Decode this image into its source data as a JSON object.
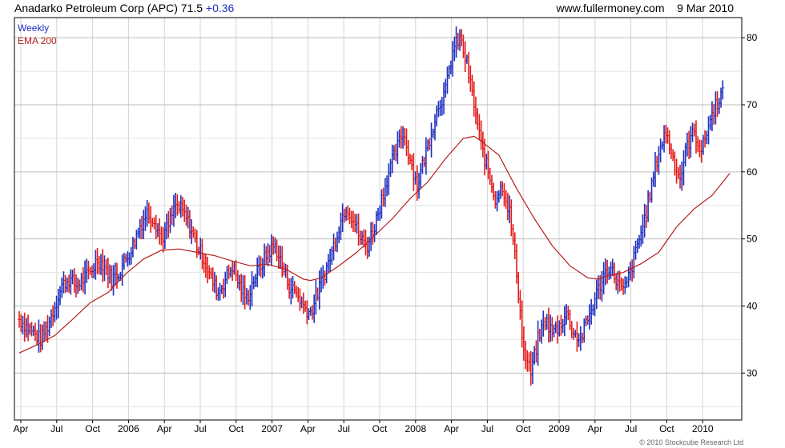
{
  "header": {
    "title": "Anadarko Petroleum Corp (APC) 71.5",
    "change": "+0.36",
    "source": "www.fullermoney.com",
    "date": "9 Mar 2010"
  },
  "legend": {
    "period": "Weekly",
    "ema": "EMA 200"
  },
  "footer": {
    "copyright": "© 2010 Stockcube Research Ltd"
  },
  "colors": {
    "up": "#1f2fbf",
    "down": "#e41a1a",
    "ema": "#b41e1e",
    "grid": "#d4d4d4"
  },
  "chart_data": {
    "type": "line",
    "title": "Anadarko Petroleum Corp (APC) 71.5",
    "x_ticks": [
      "Apr",
      "Jul",
      "Oct",
      "2006",
      "Apr",
      "Jul",
      "Oct",
      "2007",
      "Apr",
      "Jul",
      "Oct",
      "2008",
      "Apr",
      "Jul",
      "Oct",
      "2009",
      "Apr",
      "Jul",
      "Oct",
      "2010"
    ],
    "y_ticks": [
      30,
      40,
      50,
      60,
      70,
      80
    ],
    "ylim": [
      23,
      83
    ],
    "grid": true,
    "legend_position": "top-left",
    "series": [
      {
        "name": "Weekly",
        "style": "price bars",
        "points": [
          [
            0,
            38
          ],
          [
            2,
            37
          ],
          [
            4,
            36
          ],
          [
            6,
            35
          ],
          [
            8,
            37
          ],
          [
            10,
            40
          ],
          [
            12,
            43
          ],
          [
            14,
            44
          ],
          [
            16,
            43
          ],
          [
            18,
            44
          ],
          [
            20,
            45
          ],
          [
            22,
            47
          ],
          [
            24,
            46
          ],
          [
            26,
            44
          ],
          [
            28,
            45
          ],
          [
            30,
            47
          ],
          [
            32,
            49
          ],
          [
            34,
            52
          ],
          [
            36,
            54
          ],
          [
            38,
            53
          ],
          [
            40,
            50
          ],
          [
            42,
            52
          ],
          [
            44,
            55
          ],
          [
            46,
            54
          ],
          [
            48,
            52
          ],
          [
            50,
            49
          ],
          [
            52,
            47
          ],
          [
            54,
            44
          ],
          [
            56,
            42
          ],
          [
            58,
            44
          ],
          [
            60,
            46
          ],
          [
            62,
            43
          ],
          [
            64,
            41
          ],
          [
            66,
            44
          ],
          [
            68,
            46
          ],
          [
            70,
            48
          ],
          [
            72,
            49
          ],
          [
            74,
            46
          ],
          [
            76,
            43
          ],
          [
            78,
            42
          ],
          [
            80,
            40
          ],
          [
            82,
            39
          ],
          [
            84,
            42
          ],
          [
            86,
            45
          ],
          [
            88,
            48
          ],
          [
            90,
            52
          ],
          [
            92,
            55
          ],
          [
            94,
            53
          ],
          [
            96,
            50
          ],
          [
            98,
            49
          ],
          [
            100,
            52
          ],
          [
            102,
            56
          ],
          [
            104,
            60
          ],
          [
            106,
            63
          ],
          [
            108,
            66
          ],
          [
            110,
            62
          ],
          [
            112,
            58
          ],
          [
            114,
            62
          ],
          [
            116,
            66
          ],
          [
            118,
            70
          ],
          [
            120,
            72
          ],
          [
            122,
            78
          ],
          [
            124,
            80
          ],
          [
            126,
            76
          ],
          [
            128,
            70
          ],
          [
            130,
            64
          ],
          [
            132,
            60
          ],
          [
            134,
            56
          ],
          [
            136,
            58
          ],
          [
            138,
            54
          ],
          [
            140,
            45
          ],
          [
            142,
            33
          ],
          [
            144,
            30
          ],
          [
            146,
            35
          ],
          [
            148,
            38
          ],
          [
            150,
            36
          ],
          [
            152,
            37
          ],
          [
            154,
            39
          ],
          [
            156,
            36
          ],
          [
            158,
            35
          ],
          [
            160,
            38
          ],
          [
            162,
            41
          ],
          [
            164,
            44
          ],
          [
            166,
            46
          ],
          [
            168,
            44
          ],
          [
            170,
            42
          ],
          [
            172,
            45
          ],
          [
            174,
            49
          ],
          [
            176,
            53
          ],
          [
            178,
            58
          ],
          [
            180,
            63
          ],
          [
            182,
            66
          ],
          [
            184,
            62
          ],
          [
            186,
            59
          ],
          [
            188,
            64
          ],
          [
            190,
            66
          ],
          [
            192,
            63
          ],
          [
            194,
            67
          ],
          [
            196,
            70
          ],
          [
            198,
            72
          ]
        ]
      },
      {
        "name": "EMA 200",
        "style": "line",
        "points": [
          [
            0,
            33
          ],
          [
            5,
            34.2
          ],
          [
            10,
            35.6
          ],
          [
            15,
            38
          ],
          [
            20,
            40.5
          ],
          [
            25,
            42
          ],
          [
            30,
            44.8
          ],
          [
            35,
            47
          ],
          [
            40,
            48.3
          ],
          [
            45,
            48.5
          ],
          [
            50,
            48
          ],
          [
            55,
            47.5
          ],
          [
            60,
            46.7
          ],
          [
            65,
            46
          ],
          [
            70,
            46.2
          ],
          [
            75,
            45.5
          ],
          [
            80,
            44
          ],
          [
            82,
            43.8
          ],
          [
            85,
            44.2
          ],
          [
            90,
            46
          ],
          [
            95,
            48
          ],
          [
            100,
            50.5
          ],
          [
            105,
            53
          ],
          [
            110,
            56
          ],
          [
            115,
            58.5
          ],
          [
            120,
            62
          ],
          [
            125,
            65
          ],
          [
            128,
            65.3
          ],
          [
            130,
            64.6
          ],
          [
            135,
            62.5
          ],
          [
            140,
            57.5
          ],
          [
            145,
            53
          ],
          [
            150,
            49
          ],
          [
            155,
            46
          ],
          [
            160,
            44.2
          ],
          [
            163,
            44
          ],
          [
            165,
            44.4
          ],
          [
            170,
            45
          ],
          [
            175,
            46.3
          ],
          [
            180,
            48
          ],
          [
            185,
            51.8
          ],
          [
            190,
            54.5
          ],
          [
            195,
            56.5
          ],
          [
            200,
            59.8
          ]
        ]
      }
    ]
  }
}
